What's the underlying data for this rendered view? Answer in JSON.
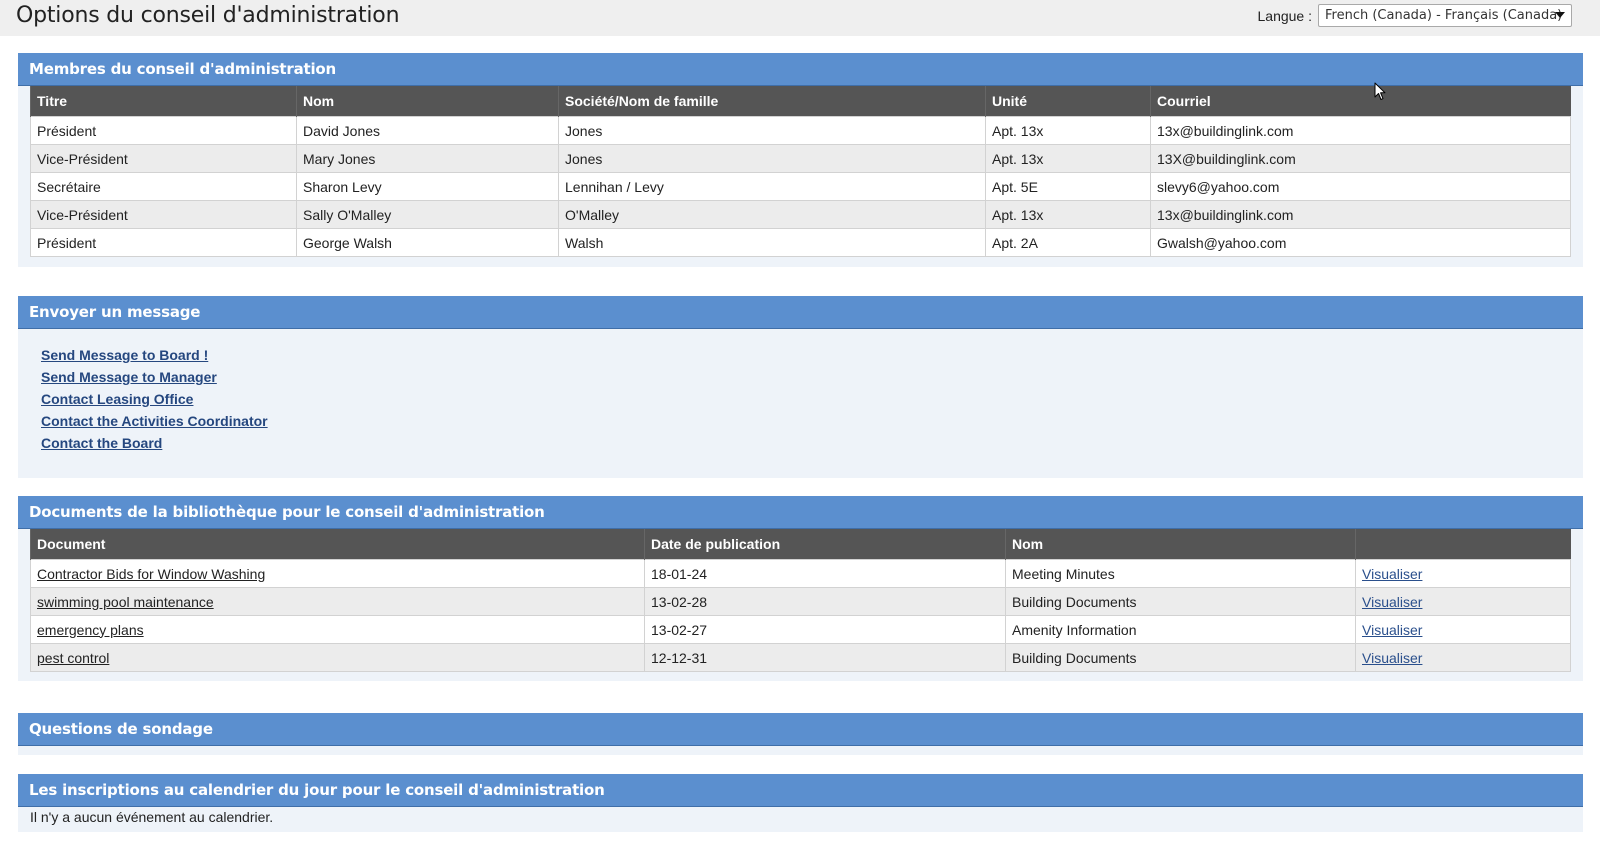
{
  "page": {
    "title": "Options du conseil d'administration",
    "language_label": "Langue :",
    "language_selected": "French (Canada) - Français (Canada)"
  },
  "board_members": {
    "header": "Membres du conseil d'administration",
    "columns": [
      "Titre",
      "Nom",
      "Société/Nom de famille",
      "Unité",
      "Courriel"
    ],
    "rows": [
      [
        "Président",
        "David Jones",
        "Jones",
        "Apt. 13x",
        "13x@buildinglink.com"
      ],
      [
        "Vice-Président",
        "Mary Jones",
        "Jones",
        "Apt. 13x",
        "13X@buildinglink.com"
      ],
      [
        "Secrétaire",
        "Sharon Levy",
        "Lennihan / Levy",
        "Apt. 5E",
        "slevy6@yahoo.com"
      ],
      [
        "Vice-Président",
        "Sally O'Malley",
        "O'Malley",
        "Apt. 13x",
        "13x@buildinglink.com"
      ],
      [
        "Président",
        "George Walsh",
        "Walsh",
        "Apt. 2A",
        "Gwalsh@yahoo.com"
      ]
    ]
  },
  "send_message": {
    "header": "Envoyer un message",
    "links": [
      " Send Message to Board !",
      " Send Message to Manager",
      "Contact Leasing Office",
      "Contact the Activities Coordinator",
      "Contact the Board"
    ]
  },
  "documents": {
    "header": "Documents de la bibliothèque pour le conseil d'administration",
    "columns": [
      "Document",
      "Date de publication",
      "Nom",
      ""
    ],
    "view_label": "Visualiser",
    "rows": [
      [
        "Contractor Bids for Window Washing",
        "18-01-24",
        "Meeting Minutes"
      ],
      [
        "swimming pool maintenance",
        "13-02-28",
        "Building Documents"
      ],
      [
        "emergency plans",
        "13-02-27",
        "Amenity Information"
      ],
      [
        "pest control",
        "12-12-31",
        "Building Documents"
      ]
    ]
  },
  "surveys": {
    "header": "Questions de sondage"
  },
  "calendar": {
    "header": "Les inscriptions au calendrier du jour pour le conseil d'administration",
    "empty_text": "Il n'y a aucun événement au calendrier."
  },
  "icons": {
    "dropdown": "chevron-down-icon",
    "pointer": "mouse-cursor-icon"
  },
  "colors": {
    "section_header": "#5b8fcf",
    "table_header": "#555555",
    "link": "#25477f",
    "section_background": "#eef3f9"
  }
}
